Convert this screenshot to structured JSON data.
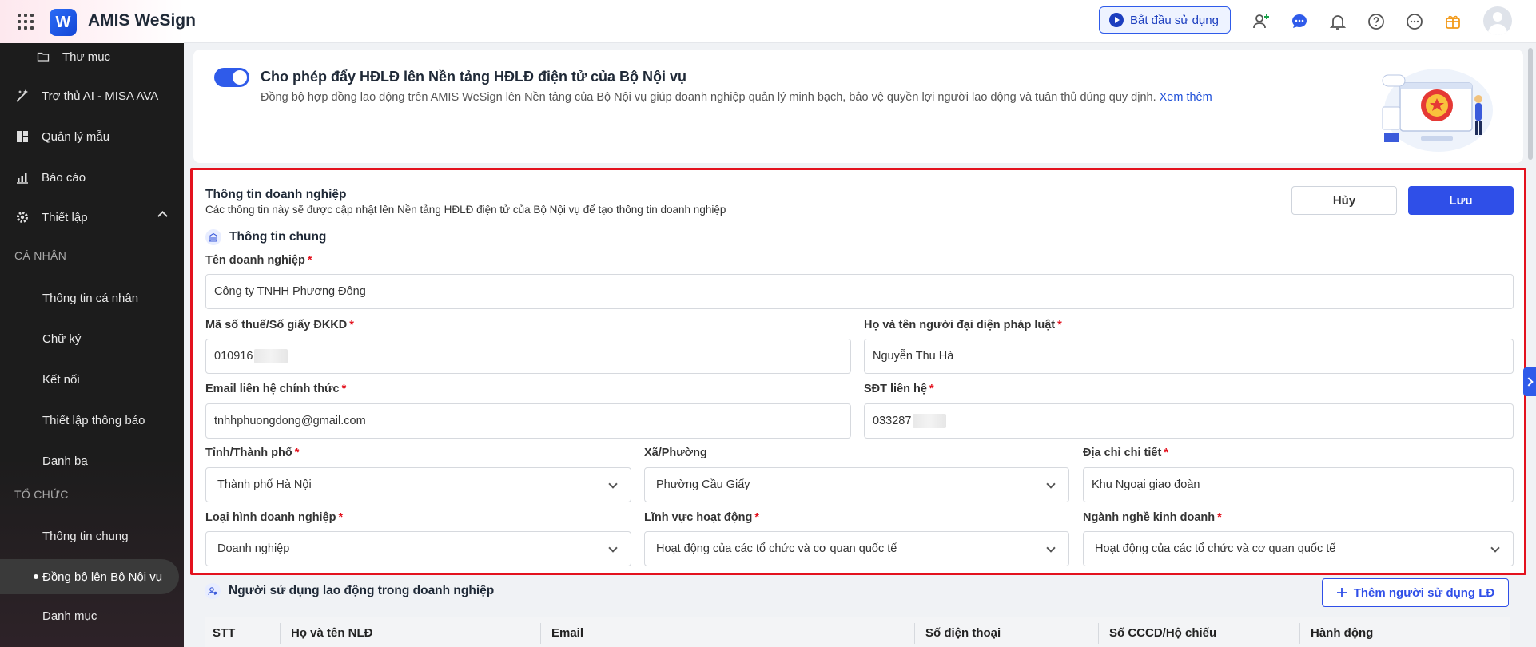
{
  "app": {
    "title": "AMIS WeSign",
    "logo_letter": "W"
  },
  "topbar": {
    "start_label": "Bắt đầu sử dụng",
    "icons": [
      "add-user-icon",
      "chat-icon",
      "bell-icon",
      "help-icon",
      "more-icon",
      "gift-icon"
    ]
  },
  "sidebar": {
    "folder": "Thư mục",
    "ai": "Trợ thủ AI - MISA AVA",
    "templates": "Quản lý mẫu",
    "reports": "Báo cáo",
    "settings": "Thiết lập",
    "section_personal": "CÁ NHÂN",
    "personal_info": "Thông tin cá nhân",
    "signature": "Chữ ký",
    "connect": "Kết nối",
    "notify": "Thiết lập thông báo",
    "contacts": "Danh bạ",
    "section_org": "TỔ CHỨC",
    "general_info": "Thông tin chung",
    "sync": "Đồng bộ lên Bộ Nội vụ",
    "catalog": "Danh mục"
  },
  "banner": {
    "title": "Cho phép đẩy HĐLĐ lên Nền tảng HĐLĐ điện tử của Bộ Nội vụ",
    "desc": "Đồng bộ hợp đồng lao động trên AMIS WeSign lên Nền tảng của Bộ Nội vụ giúp doanh nghiệp quản lý minh bạch, bảo vệ quyền lợi người lao động và tuân thủ đúng quy định.",
    "link": "Xem thêm",
    "toggle_on": true
  },
  "form": {
    "title": "Thông tin doanh nghiệp",
    "subtitle": "Các thông tin này sẽ được cập nhật lên Nền tảng HĐLĐ điện tử của Bộ Nội vụ để tạo thông tin doanh nghiệp",
    "cancel": "Hủy",
    "save": "Lưu",
    "section": "Thông tin chung",
    "required_mark": "*",
    "company_name_label": "Tên doanh nghiệp",
    "company_name": "Công ty TNHH Phương Đông",
    "tax_label": "Mã số thuế/Số giấy ĐKKD",
    "tax_value": "010916",
    "rep_label": "Họ và tên người đại diện pháp luật",
    "rep_value": "Nguyễn Thu Hà",
    "email_label": "Email liên hệ chính thức",
    "email_value": "tnhhphuongdong@gmail.com",
    "phone_label": "SĐT liên hệ",
    "phone_value": "033287",
    "province_label": "Tỉnh/Thành phố",
    "province_value": "Thành phố Hà Nội",
    "ward_label": "Xã/Phường",
    "ward_value": "Phường Cầu Giấy",
    "address_label": "Địa chỉ chi tiết",
    "address_value": "Khu Ngoại giao đoàn",
    "type_label": "Loại hình doanh nghiệp",
    "type_value": "Doanh nghiệp",
    "field_label": "Lĩnh vực hoạt động",
    "field_value": "Hoạt động của các tổ chức và cơ quan quốc tế",
    "industry_label": "Ngành nghề kinh doanh",
    "industry_value": "Hoạt động của các tổ chức và cơ quan quốc tế"
  },
  "users": {
    "title": "Người sử dụng lao động trong doanh nghiệp",
    "add": "Thêm người sử dụng LĐ",
    "columns": [
      "STT",
      "Họ và tên NLĐ",
      "Email",
      "Số điện thoại",
      "Số CCCD/Hộ chiếu",
      "Hành động"
    ]
  },
  "colors": {
    "accent": "#2f4fe8",
    "highlight_border": "#e3121e",
    "sidebar_bg": "#1c1c1c"
  }
}
